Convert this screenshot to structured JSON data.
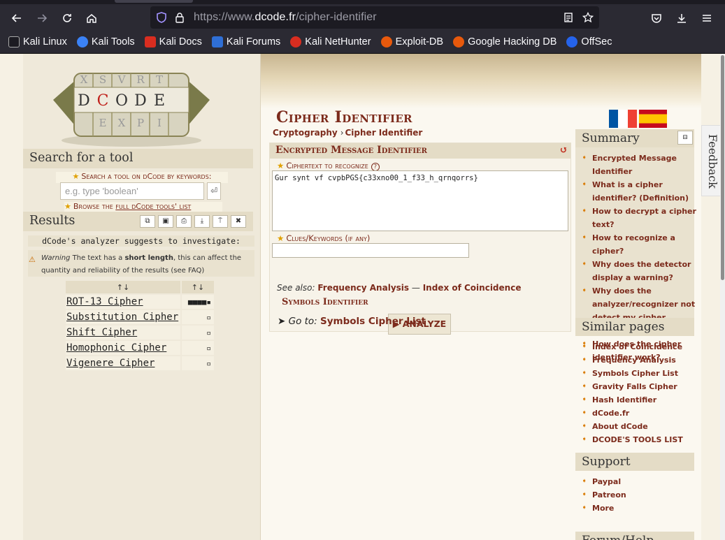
{
  "browser": {
    "url_prefix": "https://www.",
    "url_domain": "dcode.fr",
    "url_path": "/cipher-identifier",
    "bookmarks": [
      "Kali Linux",
      "Kali Tools",
      "Kali Docs",
      "Kali Forums",
      "Kali NetHunter",
      "Exploit-DB",
      "Google Hacking DB",
      "OffSec"
    ]
  },
  "sidebar": {
    "search_title": "Search for a tool",
    "search_label": "Search a tool on dCode by keywords:",
    "search_placeholder": "e.g. type 'boolean'",
    "search_go": "⏎",
    "browse_prefix": "Browse the ",
    "browse_link": "full dCode tools' list",
    "results_title": "Results",
    "analyzer_text": "dCode's analyzer suggests to investigate:",
    "warning_label": "Warning",
    "warning_text_1": " The text has a ",
    "warning_bold": "short length",
    "warning_text_2": ", this can affect the quantity and reliability of the results (see FAQ)",
    "table_headers": [
      "↑↓",
      "↑↓"
    ],
    "results": [
      {
        "name": "ROT-13 Cipher",
        "score": "■■■■▪"
      },
      {
        "name": "Substitution Cipher",
        "score": "▫"
      },
      {
        "name": "Shift Cipher",
        "score": "▫"
      },
      {
        "name": "Homophonic Cipher",
        "score": "▫"
      },
      {
        "name": "Vigenere Cipher",
        "score": "▫"
      }
    ]
  },
  "main": {
    "title": "Cipher Identifier",
    "breadcrumb": [
      "Cryptography",
      "Cipher Identifier"
    ],
    "tool_title": "Encrypted Message Identifier",
    "ciphertext_label": "Ciphertext to recognize",
    "ciphertext_value": "Gur synt vf cvpbPGS{c33xno00_1_f33_h_qrnqorrs}",
    "clues_label": "Clues/Keywords (if any)",
    "analyze_button": "▶ ANALYZE",
    "see_also_label": "See also:",
    "see_also_1": "Frequency Analysis",
    "see_also_sep": "—",
    "see_also_2": "Index of Coincidence",
    "symbols_title": "Symbols Identifier",
    "goto_label": "➤ Go to: ",
    "goto_link": "Symbols Cipher List"
  },
  "right": {
    "summary_title": "Summary",
    "summary_toggle": "⊟",
    "summary_items": [
      "Encrypted Message Identifier",
      "What is a cipher identifier? (Definition)",
      "How to decrypt a cipher text?",
      "How to recognize a cipher?",
      "Why does the detector display a warning?",
      "Why does the analyzer/recognizer not detect my cipher method?",
      "How does the cipher identifier work?"
    ],
    "similar_title": "Similar pages",
    "similar_items": [
      "Index of Coincidence",
      "Frequency Analysis",
      "Symbols Cipher List",
      "Gravity Falls Cipher",
      "Hash Identifier",
      "dCode.fr",
      "About dCode",
      "DCODE'S TOOLS LIST"
    ],
    "support_title": "Support",
    "support_items": [
      "Paypal",
      "Patreon",
      "More"
    ],
    "forum_title": "Forum/Help",
    "feedback": "Feedback"
  }
}
